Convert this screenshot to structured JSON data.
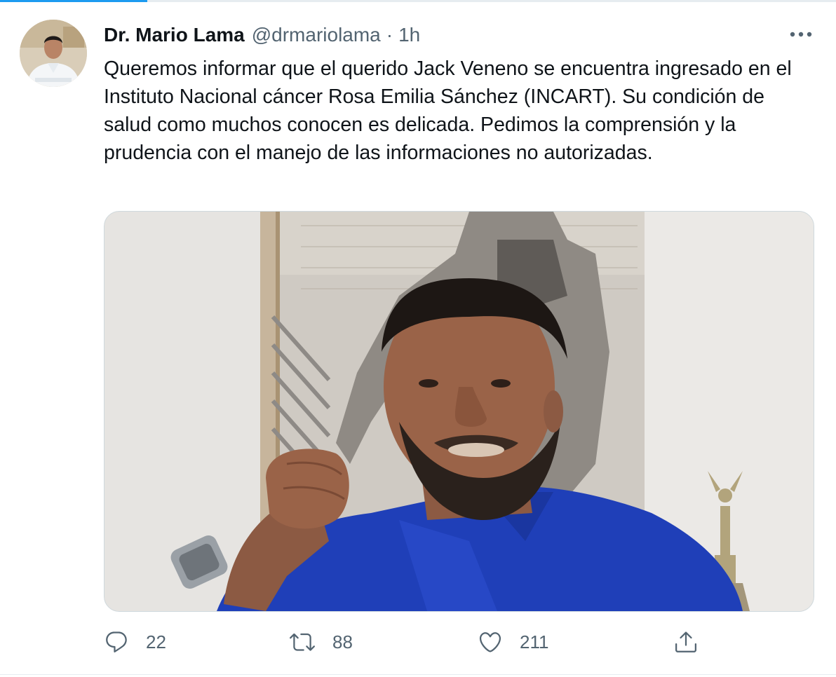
{
  "tweet": {
    "author_name": "Dr. Mario Lama",
    "author_handle": "@drmariolama",
    "separator": "·",
    "time": "1h",
    "text": "Queremos informar que el querido Jack Veneno se encuentra ingresado en el Instituto Nacional cáncer Rosa Emilia Sánchez (INCART). Su condición de salud como muchos conocen es delicada. Pedimos la comprensión y la prudencia con el manejo de las informaciones no autorizadas."
  },
  "actions": {
    "reply_count": "22",
    "retweet_count": "88",
    "like_count": "211"
  },
  "icons": {
    "more": "more-horizontal-icon",
    "reply": "reply-icon",
    "retweet": "retweet-icon",
    "like": "heart-icon",
    "share": "share-icon"
  },
  "colors": {
    "accent": "#1d9bf0",
    "text": "#0f1419",
    "secondary_text": "#536471",
    "border": "#cfd9de"
  }
}
